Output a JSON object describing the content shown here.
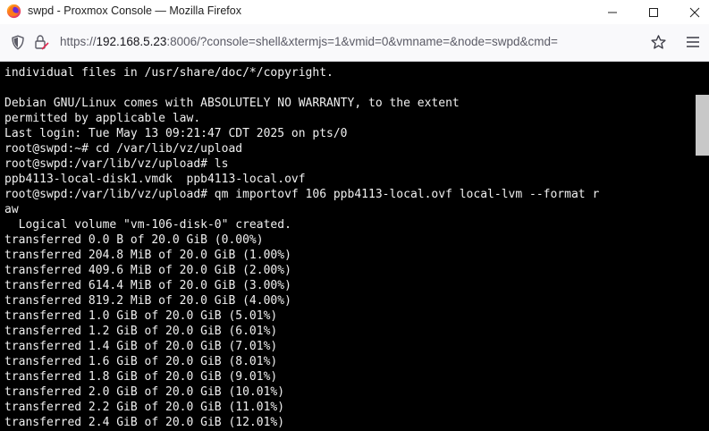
{
  "window": {
    "title": "swpd - Proxmox Console — Mozilla Firefox",
    "app_icon": "firefox-logo",
    "controls": [
      "minimize-icon",
      "maximize-icon",
      "close-icon"
    ]
  },
  "address_bar": {
    "scheme": "https://",
    "host": "192.168.5.23",
    "rest": ":8006/?console=shell&xtermjs=1&vmid=0&vmname=&node=swpd&cmd=",
    "icons": [
      "shield-icon",
      "lock-icon",
      "bookmark-star-icon",
      "hamburger-menu-icon"
    ]
  },
  "terminal": {
    "background": "#000000",
    "foreground": "#f0f0f0",
    "lines": [
      "individual files in /usr/share/doc/*/copyright.",
      "",
      "Debian GNU/Linux comes with ABSOLUTELY NO WARRANTY, to the extent",
      "permitted by applicable law.",
      "Last login: Tue May 13 09:21:47 CDT 2025 on pts/0",
      "root@swpd:~# cd /var/lib/vz/upload",
      "root@swpd:/var/lib/vz/upload# ls",
      "ppb4113-local-disk1.vmdk  ppb4113-local.ovf",
      "root@swpd:/var/lib/vz/upload# qm importovf 106 ppb4113-local.ovf local-lvm --format r",
      "aw",
      "  Logical volume \"vm-106-disk-0\" created.",
      "transferred 0.0 B of 20.0 GiB (0.00%)",
      "transferred 204.8 MiB of 20.0 GiB (1.00%)",
      "transferred 409.6 MiB of 20.0 GiB (2.00%)",
      "transferred 614.4 MiB of 20.0 GiB (3.00%)",
      "transferred 819.2 MiB of 20.0 GiB (4.00%)",
      "transferred 1.0 GiB of 20.0 GiB (5.01%)",
      "transferred 1.2 GiB of 20.0 GiB (6.01%)",
      "transferred 1.4 GiB of 20.0 GiB (7.01%)",
      "transferred 1.6 GiB of 20.0 GiB (8.01%)",
      "transferred 1.8 GiB of 20.0 GiB (9.01%)",
      "transferred 2.0 GiB of 20.0 GiB (10.01%)",
      "transferred 2.2 GiB of 20.0 GiB (11.01%)",
      "transferred 2.4 GiB of 20.0 GiB (12.01%)"
    ]
  }
}
